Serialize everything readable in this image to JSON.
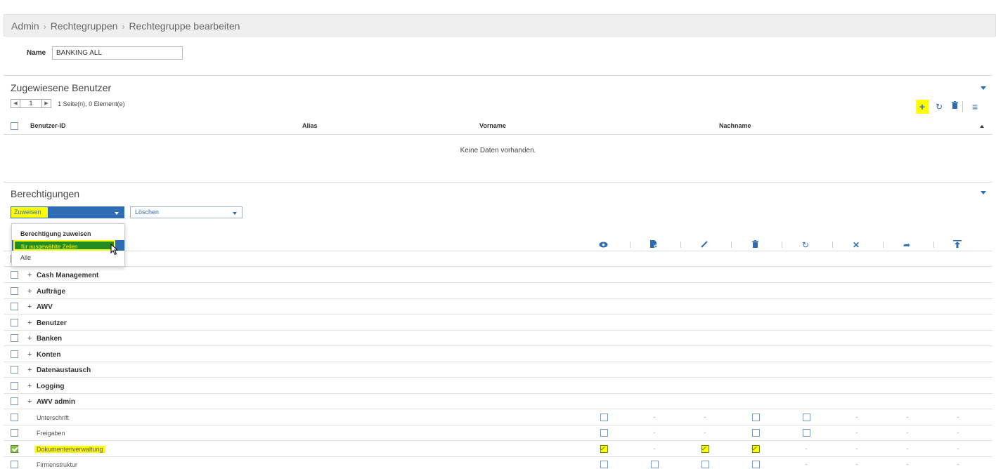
{
  "breadcrumb": {
    "items": [
      "Admin",
      "Rechtegruppen",
      "Rechtegruppe bearbeiten"
    ],
    "separator": "›"
  },
  "name_field": {
    "label": "Name",
    "value": "BANKING ALL"
  },
  "assigned_users": {
    "title": "Zugewiesene Benutzer",
    "pager": {
      "page": "1",
      "info": "1 Seite(n), 0 Element(e)"
    },
    "columns": [
      "Benutzer-ID",
      "Alias",
      "Vorname",
      "Nachname"
    ],
    "empty_text": "Keine Daten vorhanden."
  },
  "permissions": {
    "title": "Berechtigungen",
    "assign_select": "Zuweisen",
    "delete_select": "Löschen",
    "dropdown": {
      "header": "Berechtigung zuweisen",
      "options": [
        "für ausgewählte Zeilen",
        "Alle"
      ]
    },
    "column_icons": [
      "view-icon",
      "new-document-icon",
      "edit-icon",
      "delete-icon",
      "refresh-icon",
      "cancel-icon",
      "forward-icon",
      "upload-icon"
    ],
    "groups": [
      "Cash Management",
      "Aufträge",
      "AWV",
      "Benutzer",
      "Banken",
      "Konten",
      "Datenaustausch",
      "Logging",
      "AWV admin"
    ],
    "items": [
      {
        "label": "Unterschrift",
        "checked": false,
        "cells": [
          "box",
          "-",
          "-",
          "box",
          "box",
          "-",
          "-",
          "-"
        ]
      },
      {
        "label": "Freigaben",
        "checked": false,
        "cells": [
          "box",
          "-",
          "-",
          "box",
          "box",
          "-",
          "-",
          "-"
        ]
      },
      {
        "label": "Dokumentenverwaltung",
        "checked": true,
        "cells": [
          "checked",
          "-",
          "checked",
          "checked",
          "-",
          "-",
          "-",
          "-"
        ]
      },
      {
        "label": "Firmenstruktur",
        "checked": false,
        "cells": [
          "box",
          "box",
          "box",
          "box",
          "-",
          "-",
          "-",
          "-"
        ]
      }
    ]
  },
  "colors": {
    "accent": "#2e6db4",
    "highlight": "#ffff00",
    "selection_green": "#228b22"
  }
}
